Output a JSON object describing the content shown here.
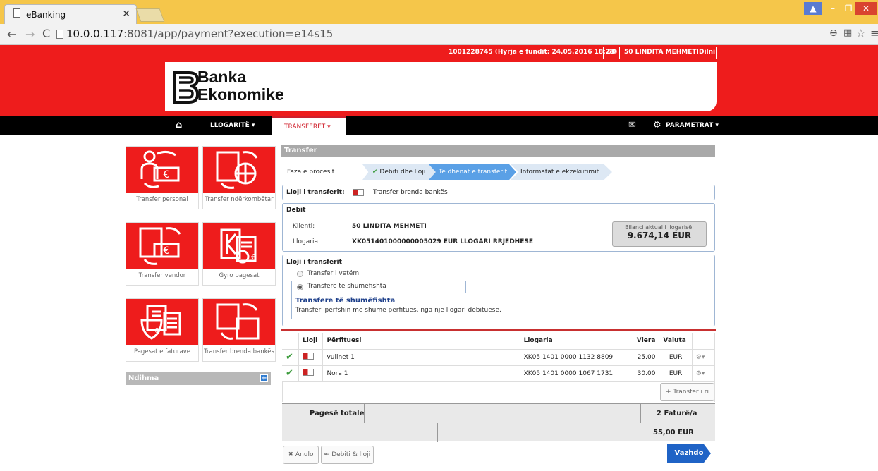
{
  "browser": {
    "tab_title": "eBanking",
    "url_host": "10.0.0.117",
    "url_rest": ":8081/app/payment?execution=e14s15"
  },
  "header": {
    "session_info": "1001228745  (Hyrja e fundit: 24.05.2016 18:28)",
    "client_code": "50",
    "client_name": "50 LINDITA MEHMETI",
    "logout": "Dilni",
    "logo_line1": "Banka",
    "logo_line2": "Ekonomike"
  },
  "nav": {
    "accounts": "LLOGARITË",
    "transfers": "TRANSFERET",
    "settings": "PARAMETRAT"
  },
  "sidebar": {
    "tiles": [
      "Transfer personal",
      "Transfer ndërkombëtar",
      "Transfer vendor",
      "Gyro pagesat",
      "Pagesat e faturave",
      "Transfer brenda bankës"
    ],
    "help": "Ndihma"
  },
  "main": {
    "title": "Transfer",
    "process_label": "Faza e procesit",
    "steps": [
      "Debiti dhe lloji",
      "Të dhënat e transferit",
      "Informatat e ekzekutimit"
    ],
    "transfer_type_label": "Lloji i transferit:",
    "transfer_type_value": "Transfer brenda bankës",
    "debit": {
      "title": "Debit",
      "client_label": "Klienti:",
      "client_value": "50 LINDITA MEHMETI",
      "account_label": "Llogaria:",
      "account_value": "XK051401000000005029 EUR LLOGARI RRJEDHESE",
      "balance_label": "Bilanci aktual i llogarisë:",
      "balance_value": "9.674,14 EUR"
    },
    "type_section": {
      "title": "Lloji i transferit",
      "option1": "Transfer i vetëm",
      "option2": "Transfere të shumëfishta",
      "info_title": "Transfere të shumëfishta",
      "info_text": "Transferi përfshin më shumë përfitues, nga një llogari debituese."
    },
    "table": {
      "headers": [
        "Lloji",
        "Përfituesi",
        "Llogaria",
        "Vlera",
        "Valuta"
      ],
      "rows": [
        {
          "beneficiary": "vullnet 1",
          "account": "XK05 1401 0000 1132 8809",
          "amount": "25.00",
          "currency": "EUR"
        },
        {
          "beneficiary": "Nora 1",
          "account": "XK05 1401 0000 1067 1731",
          "amount": "30.00",
          "currency": "EUR"
        }
      ],
      "add_button": "Transfer i ri"
    },
    "totals": {
      "label": "Pagesë totale",
      "count": "2 Faturë/a",
      "amount": "55,00 EUR"
    },
    "buttons": {
      "cancel": "Anulo",
      "back": "Debiti & lloji",
      "next": "Vazhdo"
    }
  },
  "colors": {
    "brand_red": "#ee1c1c",
    "step_active": "#5aa0e6",
    "link_blue": "#1d3f8a"
  }
}
